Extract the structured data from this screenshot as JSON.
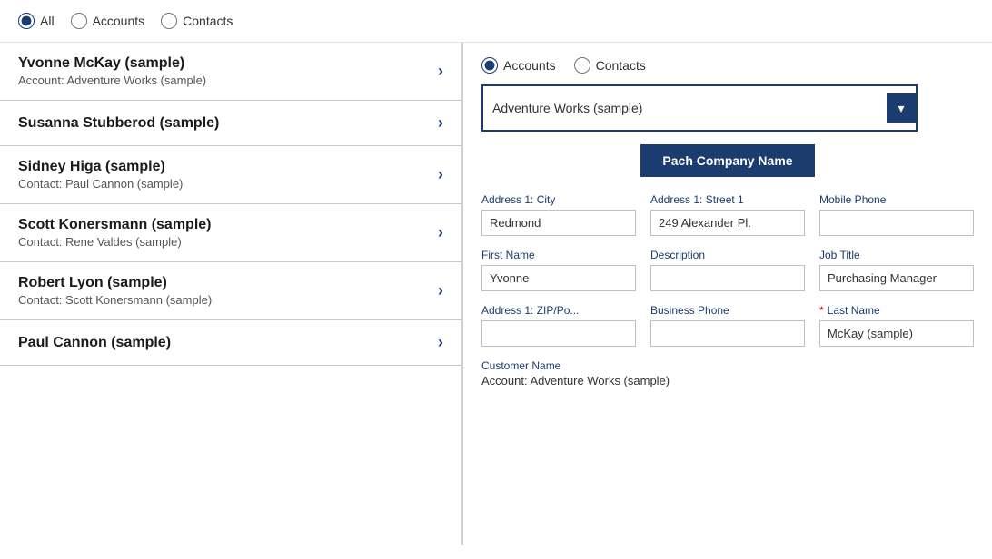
{
  "topFilter": {
    "options": [
      {
        "id": "all",
        "label": "All",
        "checked": true
      },
      {
        "id": "accounts",
        "label": "Accounts",
        "checked": false
      },
      {
        "id": "contacts",
        "label": "Contacts",
        "checked": false
      }
    ]
  },
  "listItems": [
    {
      "title": "Yvonne McKay (sample)",
      "subtitle": "Account: Adventure Works (sample)"
    },
    {
      "title": "Susanna Stubberod (sample)",
      "subtitle": ""
    },
    {
      "title": "Sidney Higa (sample)",
      "subtitle": "Contact: Paul Cannon (sample)"
    },
    {
      "title": "Scott Konersmann (sample)",
      "subtitle": "Contact: Rene Valdes (sample)"
    },
    {
      "title": "Robert Lyon (sample)",
      "subtitle": "Contact: Scott Konersmann (sample)"
    },
    {
      "title": "Paul Cannon (sample)",
      "subtitle": ""
    }
  ],
  "rightPanel": {
    "filterOptions": [
      {
        "id": "accounts",
        "label": "Accounts",
        "checked": true
      },
      {
        "id": "contacts",
        "label": "Contacts",
        "checked": false
      }
    ],
    "dropdown": {
      "value": "Adventure Works (sample)",
      "placeholder": "Adventure Works (sample)"
    },
    "patchButton": "Pach Company Name",
    "fields": [
      {
        "label": "Address 1: City",
        "value": "Redmond",
        "required": false,
        "name": "address1-city"
      },
      {
        "label": "Address 1: Street 1",
        "value": "249 Alexander Pl.",
        "required": false,
        "name": "address1-street1"
      },
      {
        "label": "Mobile Phone",
        "value": "",
        "required": false,
        "name": "mobile-phone"
      },
      {
        "label": "First Name",
        "value": "Yvonne",
        "required": false,
        "name": "first-name"
      },
      {
        "label": "Description",
        "value": "",
        "required": false,
        "name": "description"
      },
      {
        "label": "Job Title",
        "value": "Purchasing Manager",
        "required": false,
        "name": "job-title"
      },
      {
        "label": "Address 1: ZIP/Po...",
        "value": "",
        "required": false,
        "name": "address1-zip"
      },
      {
        "label": "Business Phone",
        "value": "",
        "required": false,
        "name": "business-phone"
      },
      {
        "label": "Last Name",
        "value": "McKay (sample)",
        "required": true,
        "name": "last-name"
      }
    ],
    "customerName": {
      "label": "Customer Name",
      "value": "Account: Adventure Works (sample)"
    }
  }
}
